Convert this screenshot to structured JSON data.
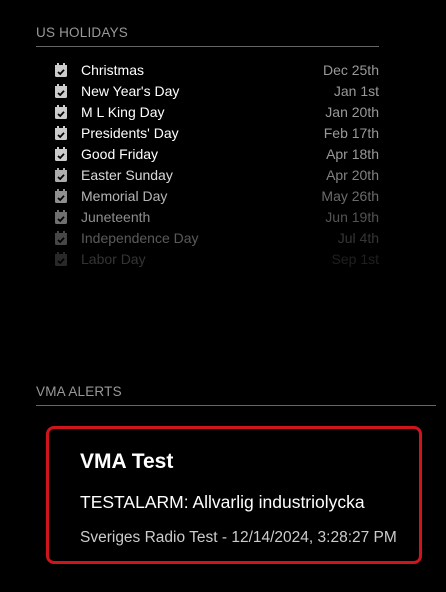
{
  "holidays_module": {
    "header": "US HOLIDAYS",
    "items": [
      {
        "name": "Christmas",
        "date": "Dec 25th",
        "icon": "calendar-check-icon"
      },
      {
        "name": "New Year's Day",
        "date": "Jan 1st",
        "icon": "calendar-check-icon"
      },
      {
        "name": "M L King Day",
        "date": "Jan 20th",
        "icon": "calendar-check-icon"
      },
      {
        "name": "Presidents' Day",
        "date": "Feb 17th",
        "icon": "calendar-check-icon"
      },
      {
        "name": "Good Friday",
        "date": "Apr 18th",
        "icon": "calendar-check-icon"
      },
      {
        "name": "Easter Sunday",
        "date": "Apr 20th",
        "icon": "calendar-check-icon"
      },
      {
        "name": "Memorial Day",
        "date": "May 26th",
        "icon": "calendar-check-icon"
      },
      {
        "name": "Juneteenth",
        "date": "Jun 19th",
        "icon": "calendar-check-icon"
      },
      {
        "name": "Independence Day",
        "date": "Jul 4th",
        "icon": "calendar-check-icon"
      },
      {
        "name": "Labor Day",
        "date": "Sep 1st",
        "icon": "calendar-check-icon"
      }
    ]
  },
  "vma_module": {
    "header": "VMA ALERTS",
    "alert": {
      "title": "VMA Test",
      "message": "TESTALARM: Allvarlig industriolycka",
      "source": "Sveriges Radio Test - 12/14/2024, 3:28:27 PM",
      "border_color": "#d0141c"
    }
  },
  "colors": {
    "background": "#000000",
    "header_text": "#999999",
    "primary_text": "#ffffff",
    "secondary_text": "#999999",
    "rule": "#666666"
  }
}
